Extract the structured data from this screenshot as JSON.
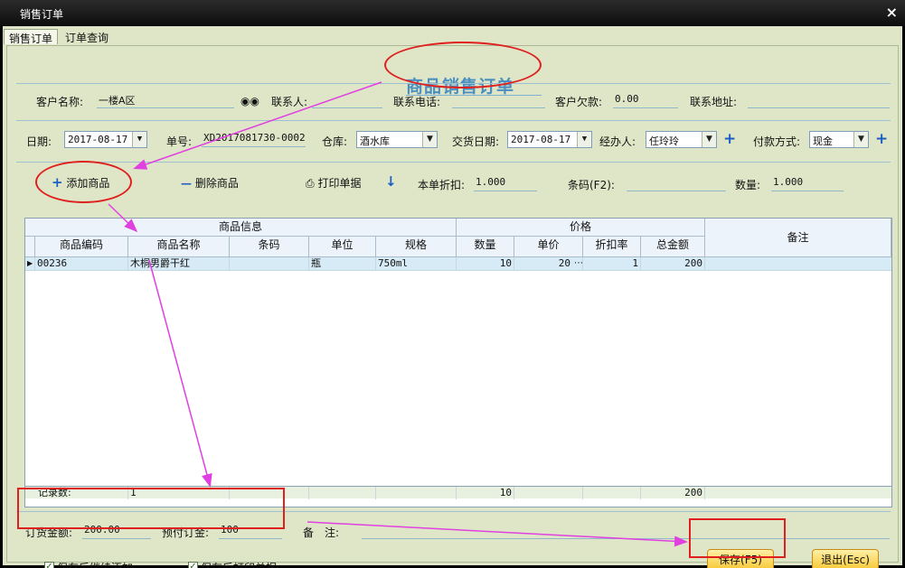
{
  "window": {
    "title": "销售订单",
    "close": "×"
  },
  "tabs": [
    {
      "label": "销售订单"
    },
    {
      "label": "订单查询"
    }
  ],
  "form_title": "商品销售订单",
  "row1": {
    "customer_label": "客户名称:",
    "customer_value": "一楼A区",
    "contact_label": "联系人:",
    "contact_value": "",
    "phone_label": "联系电话:",
    "phone_value": "",
    "debt_label": "客户欠款:",
    "debt_value": "0.00",
    "address_label": "联系地址:",
    "address_value": ""
  },
  "row2": {
    "date_label": "日期:",
    "date_value": "2017-08-17",
    "no_label": "单号:",
    "no_value": "XD2017081730-0002",
    "warehouse_label": "仓库:",
    "warehouse_value": "酒水库",
    "delivery_label": "交货日期:",
    "delivery_value": "2017-08-17",
    "handler_label": "经办人:",
    "handler_value": "任玲玲",
    "pay_label": "付款方式:",
    "pay_value": "现金"
  },
  "toolbar": {
    "add_label": "添加商品",
    "delete_label": "删除商品",
    "print_label": "打印单据",
    "discount_label": "本单折扣:",
    "discount_value": "1.000",
    "barcode_label": "条码(F2):",
    "barcode_value": "",
    "qty_label": "数量:",
    "qty_value": "1.000"
  },
  "grid": {
    "group_goods": "商品信息",
    "group_price": "价格",
    "remark_header": "备注",
    "columns": [
      "商品编码",
      "商品名称",
      "条码",
      "单位",
      "规格",
      "数量",
      "单价",
      "折扣率",
      "总金额"
    ],
    "rows": [
      {
        "code": "00236",
        "name": "木桐男爵干红",
        "barcode": "",
        "unit": "瓶",
        "spec": "750ml",
        "qty": "10",
        "price": "20",
        "rate": "1",
        "total": "200",
        "remark": ""
      }
    ],
    "summary": {
      "label": "记录数:",
      "count": "1",
      "qty": "10",
      "total": "200"
    }
  },
  "footer": {
    "order_amount_label": "订货金额:",
    "order_amount_value": "200.00",
    "prepay_label": "预付订金:",
    "prepay_value": "100",
    "remark_label": "备　注:",
    "remark_value": "",
    "continue_label": "保存后继续添加",
    "print_after_label": "保存后打印单据",
    "save_label": "保存(F5)",
    "exit_label": "退出(Esc)"
  },
  "colors": {
    "background": "#dfe6c8",
    "title": "#4a8fc0",
    "annotation_red": "#e0201e",
    "annotation_magenta": "#e040e0",
    "button": "#f6c52e"
  },
  "icons": [
    "binoculars-icon",
    "plus-icon",
    "minus-icon",
    "printer-icon",
    "down-arrow-icon",
    "dropdown-arrow-icon",
    "checkbox-icon"
  ]
}
